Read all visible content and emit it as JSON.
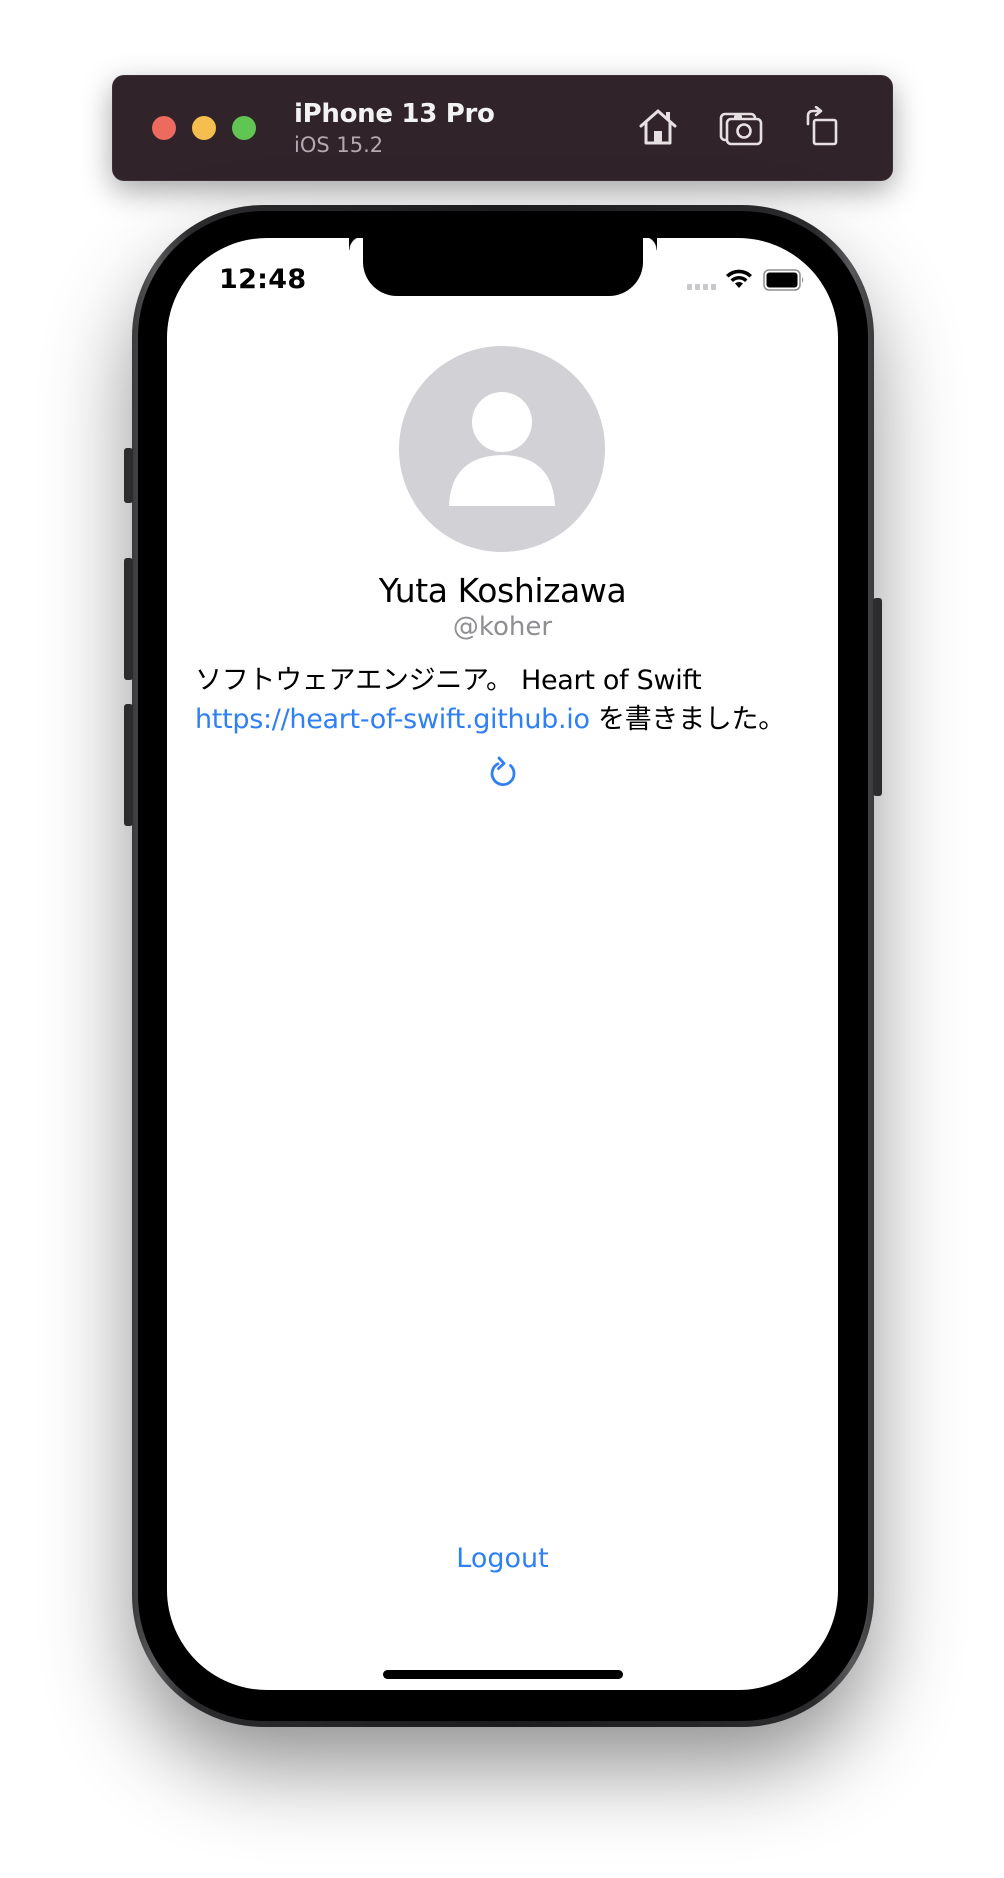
{
  "simulator": {
    "device_name": "iPhone 13 Pro",
    "os_version": "iOS 15.2",
    "toolbar": {
      "home_icon": "house-icon",
      "screenshot_icon": "camera-icon",
      "rotate_icon": "rotate-icon"
    }
  },
  "status_bar": {
    "time": "12:48"
  },
  "profile": {
    "avatar_icon": "person-placeholder-icon",
    "name": "Yuta Koshizawa",
    "handle": "@koher",
    "bio_prefix": "ソフトウェアエンジニア。 Heart of Swift ",
    "bio_link": "https://heart-of-swift.github.io",
    "bio_suffix": " を書きました。"
  },
  "actions": {
    "refresh_icon": "arrow-clockwise-icon",
    "logout_label": "Logout"
  },
  "colors": {
    "accent": "#2f7ff5",
    "secondary_text": "#8e8e93",
    "avatar_bg": "#d1d1d6",
    "sim_bar_bg": "#30232a"
  }
}
